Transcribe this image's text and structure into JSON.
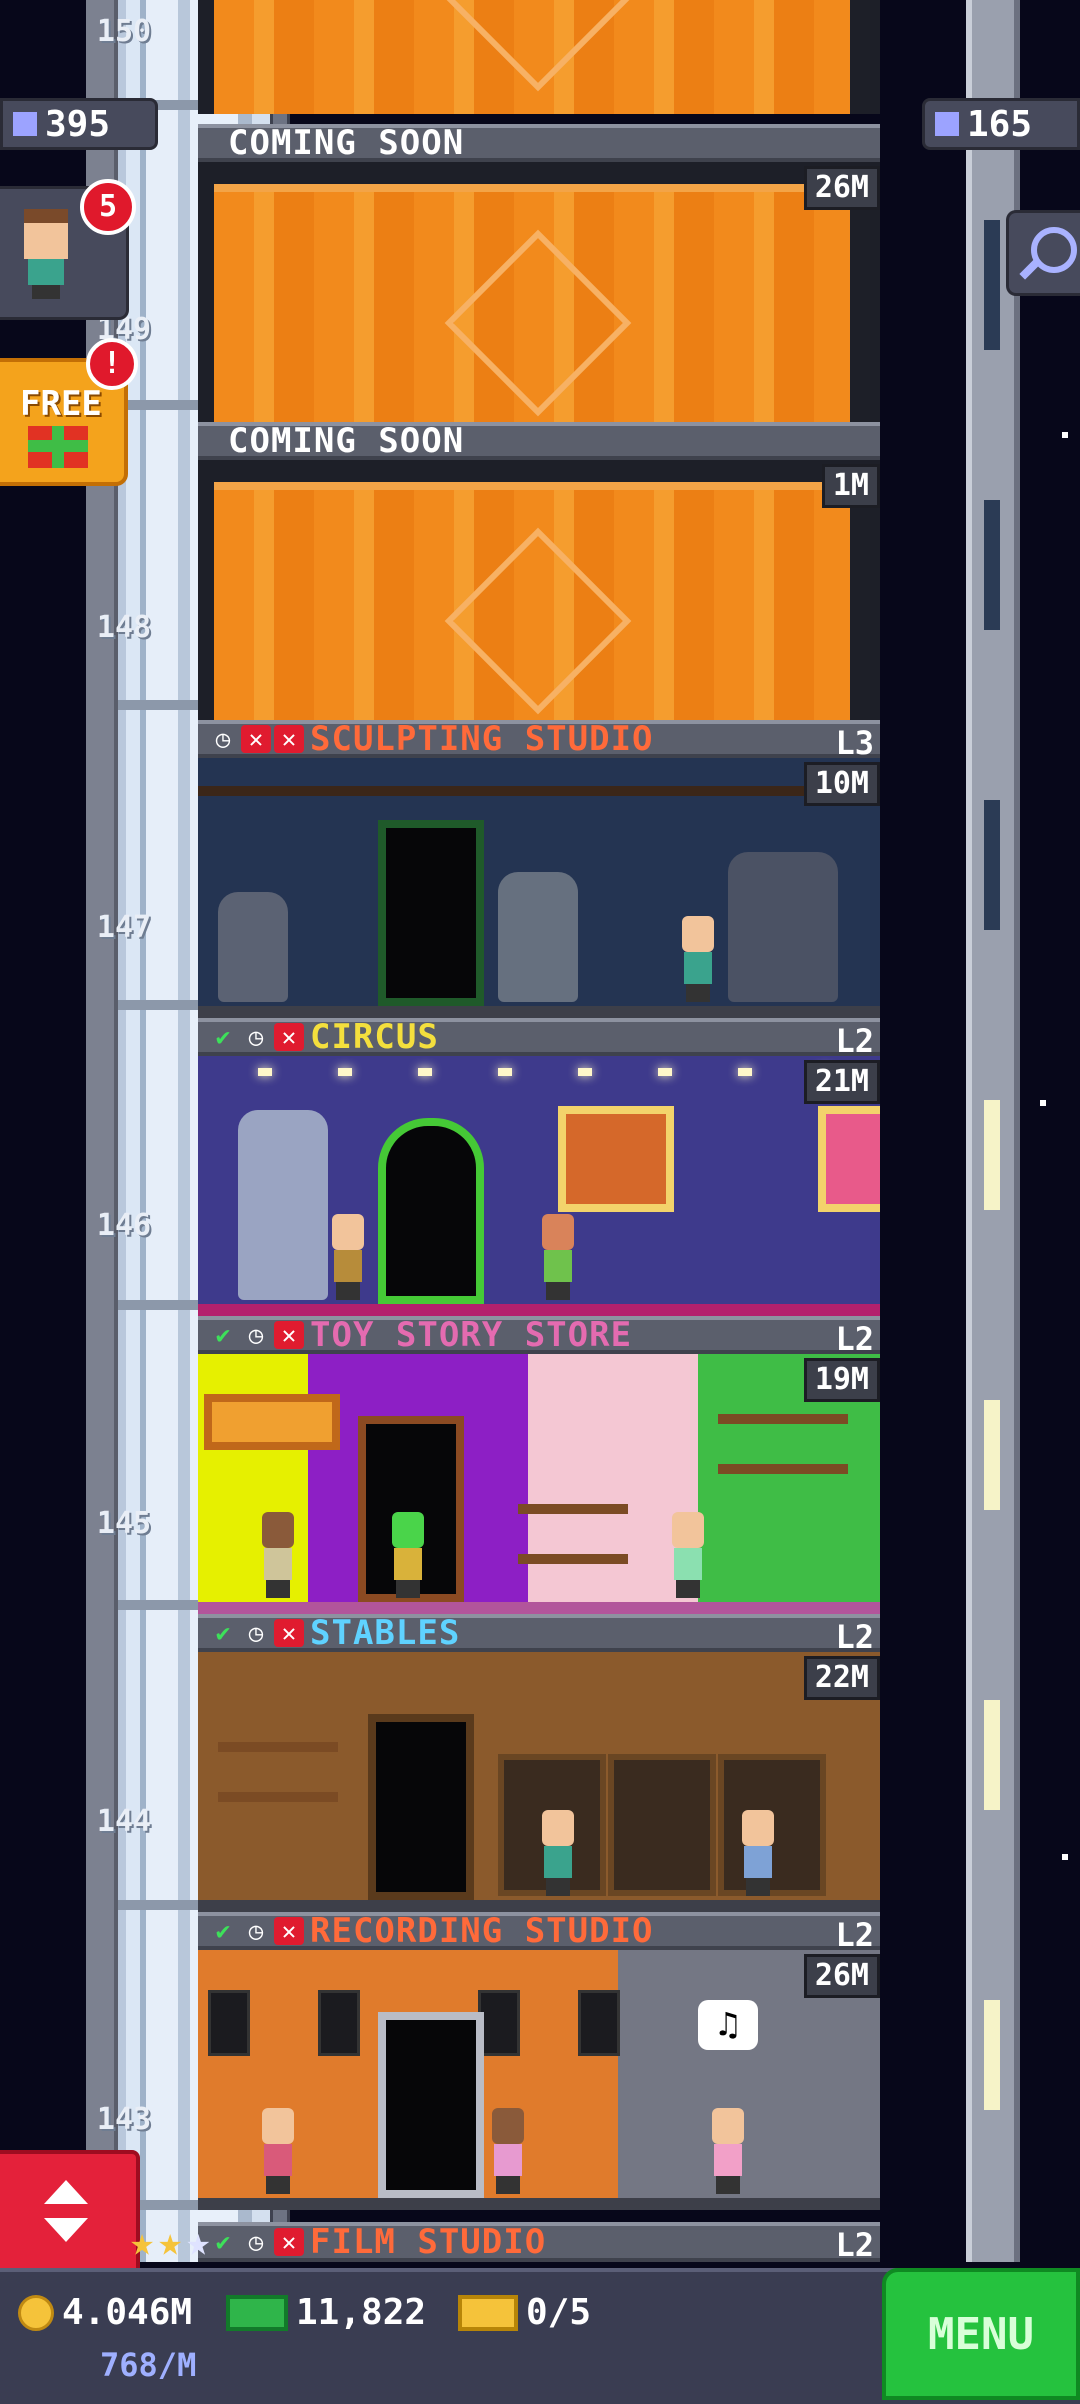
{
  "hud": {
    "population": "395",
    "floor_count": "165",
    "bitizen_alert_count": "5",
    "free_gift_label": "FREE",
    "free_gift_alert": "!",
    "coins": "4.046M",
    "income": "768/M",
    "bux": "11,822",
    "tickets": "0/5",
    "menu_label": "MENU"
  },
  "floors": [
    {
      "number": "150",
      "name": "",
      "cost": "",
      "level": ""
    },
    {
      "number": "149",
      "name": "COMING SOON",
      "cost": "26M",
      "level": ""
    },
    {
      "number": "148",
      "name": "COMING SOON",
      "cost": "1M",
      "level": ""
    },
    {
      "number": "147",
      "name": "SCULPTING STUDIO",
      "cost": "10M",
      "level": "L3",
      "name_color": "#ff6a3a"
    },
    {
      "number": "146",
      "name": "CIRCUS",
      "cost": "21M",
      "level": "L2",
      "name_color": "#f4df3d"
    },
    {
      "number": "145",
      "name": "TOY STORY STORE",
      "cost": "19M",
      "level": "L2",
      "name_color": "#e46bb0"
    },
    {
      "number": "144",
      "name": "STABLES",
      "cost": "22M",
      "level": "L2",
      "name_color": "#5fd2ff"
    },
    {
      "number": "143",
      "name": "RECORDING STUDIO",
      "cost": "26M",
      "level": "L2",
      "name_color": "#ff6a3a"
    },
    {
      "number": "",
      "name": "FILM STUDIO",
      "cost": "",
      "level": "L2",
      "name_color": "#ff6a3a"
    }
  ],
  "colors": {
    "coming_soon": "#f28a1c",
    "menu": "#25c23e",
    "elevator_button": "#e4213a"
  },
  "icons": {
    "sculpting": [
      "clock-icon",
      "x-icon",
      "x-icon"
    ],
    "built": [
      "check-icon",
      "clock-icon",
      "x-icon"
    ]
  }
}
